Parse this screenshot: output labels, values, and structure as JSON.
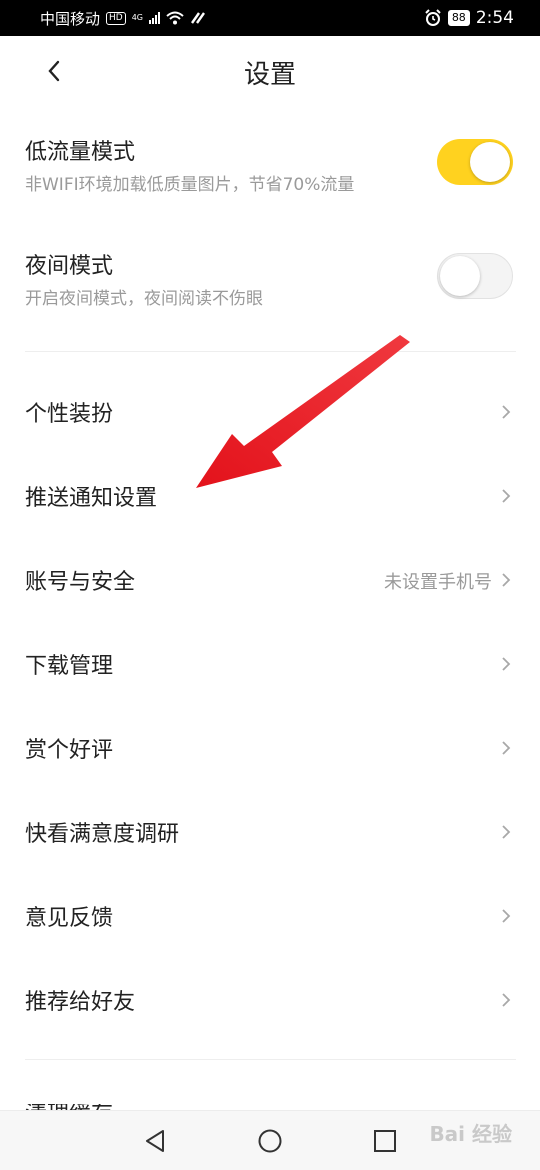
{
  "status_bar": {
    "carrier": "中国移动",
    "hd_badge": "HD",
    "network": "4G",
    "battery": "88",
    "time": "2:54"
  },
  "header": {
    "title": "设置"
  },
  "toggles": [
    {
      "title": "低流量模式",
      "subtitle": "非WIFI环境加载低质量图片，节省70%流量",
      "on": true
    },
    {
      "title": "夜间模式",
      "subtitle": "开启夜间模式，夜间阅读不伤眼",
      "on": false
    }
  ],
  "menu": [
    {
      "label": "个性装扮",
      "value": ""
    },
    {
      "label": "推送通知设置",
      "value": ""
    },
    {
      "label": "账号与安全",
      "value": "未设置手机号"
    },
    {
      "label": "下载管理",
      "value": ""
    },
    {
      "label": "赏个好评",
      "value": ""
    },
    {
      "label": "快看满意度调研",
      "value": ""
    },
    {
      "label": "意见反馈",
      "value": ""
    },
    {
      "label": "推荐给好友",
      "value": ""
    }
  ],
  "partial_row": "清理缓存",
  "colors": {
    "accent": "#ffd21f",
    "annotation_arrow": "#e3121b"
  },
  "watermark": "Bai 经验"
}
